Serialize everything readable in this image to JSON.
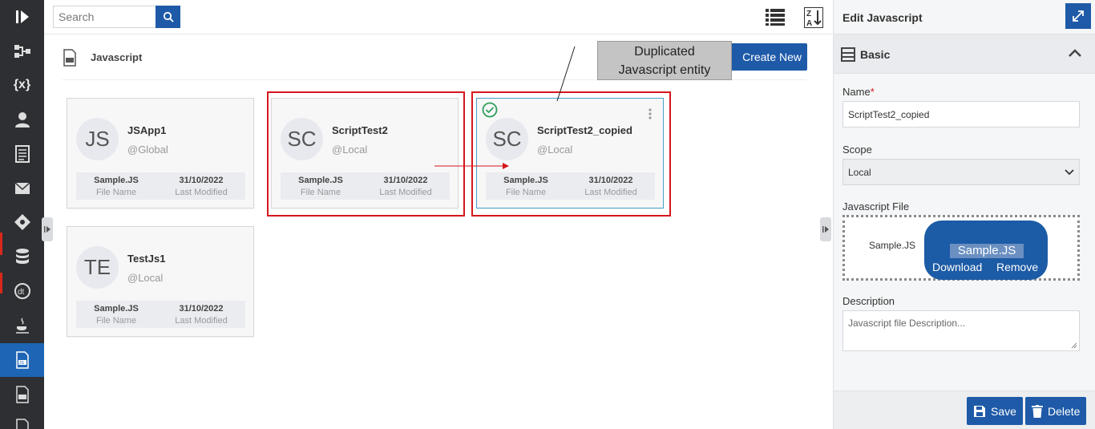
{
  "search": {
    "placeholder": "Search"
  },
  "page": {
    "title": "Javascript"
  },
  "toolbar": {
    "create_label": "Create New"
  },
  "callout": {
    "line1": "Duplicated",
    "line2": "Javascript entity"
  },
  "cards": [
    {
      "initials": "JS",
      "name": "JSApp1",
      "scope": "@Global",
      "file": "Sample.JS",
      "file_label": "File Name",
      "modified": "31/10/2022",
      "modified_label": "Last Modified"
    },
    {
      "initials": "SC",
      "name": "ScriptTest2",
      "scope": "@Local",
      "file": "Sample.JS",
      "file_label": "File Name",
      "modified": "31/10/2022",
      "modified_label": "Last Modified"
    },
    {
      "initials": "SC",
      "name": "ScriptTest2_copied",
      "scope": "@Local",
      "file": "Sample.JS",
      "file_label": "File Name",
      "modified": "31/10/2022",
      "modified_label": "Last Modified"
    },
    {
      "initials": "TE",
      "name": "TestJs1",
      "scope": "@Local",
      "file": "Sample.JS",
      "file_label": "File Name",
      "modified": "31/10/2022",
      "modified_label": "Last Modified"
    }
  ],
  "panel": {
    "title": "Edit Javascript",
    "section": "Basic",
    "name_label": "Name",
    "required_mark": "*",
    "name_value": "ScriptTest2_copied",
    "scope_label": "Scope",
    "scope_value": "Local",
    "file_label": "Javascript File",
    "file_name": "Sample.JS",
    "file_popup_name": "Sample.JS",
    "download_label": "Download",
    "remove_label": "Remove",
    "description_label": "Description",
    "description_placeholder": "Javascript file Description...",
    "save_label": "Save",
    "delete_label": "Delete"
  },
  "colors": {
    "accent": "#1e5aa8",
    "rail": "#2d2f33",
    "highlight": "#d6161e",
    "selected_border": "#4aa0c8",
    "check": "#2e9e5b"
  },
  "rail_icons": [
    "logo-icon",
    "flow-icon",
    "variable-icon",
    "user-icon",
    "document-icon",
    "mail-icon",
    "diamond-icon",
    "database-icon",
    "dt-icon",
    "java-icon",
    "javascript-file-icon",
    "css-file-icon",
    "file-icon"
  ]
}
